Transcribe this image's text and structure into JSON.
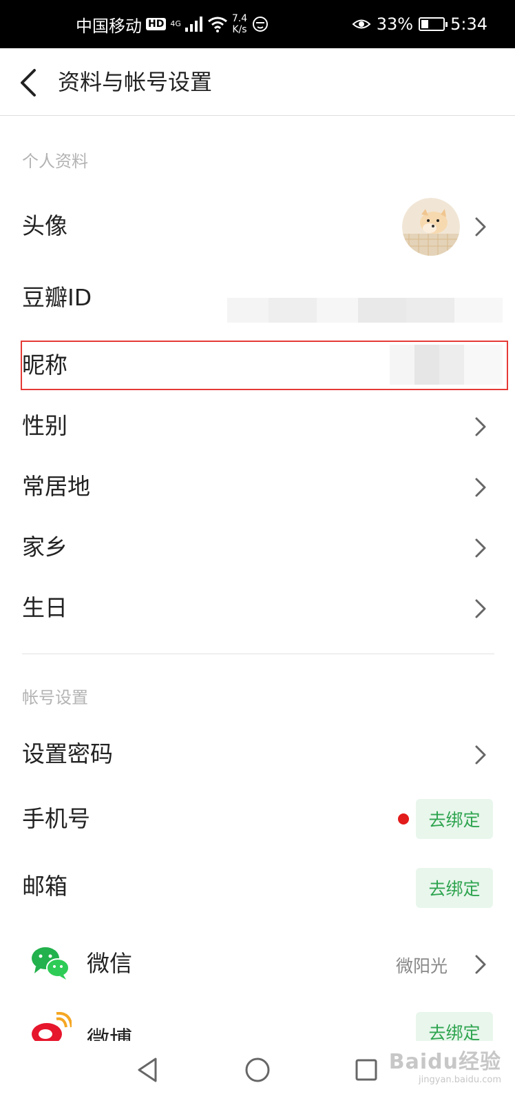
{
  "status_bar": {
    "carrier": "中国移动",
    "hd": "HD",
    "network": "4G",
    "speed_value": "7.4",
    "speed_unit": "K/s",
    "battery": "33%",
    "time": "5:34"
  },
  "header": {
    "title": "资料与帐号设置"
  },
  "profile_section": {
    "title": "个人资料",
    "rows": [
      {
        "label": "头像"
      },
      {
        "label": "豆瓣ID"
      },
      {
        "label": "昵称"
      },
      {
        "label": "性别"
      },
      {
        "label": "常居地"
      },
      {
        "label": "家乡"
      },
      {
        "label": "生日"
      }
    ]
  },
  "account_section": {
    "title": "帐号设置",
    "password_label": "设置密码",
    "phone_label": "手机号",
    "phone_button": "去绑定",
    "email_label": "邮箱",
    "email_button": "去绑定",
    "wechat_label": "微信",
    "wechat_value": "微阳光",
    "weibo_label": "微博",
    "weibo_button": "去绑定"
  },
  "colors": {
    "accent_green": "#2ea44f",
    "highlight_red": "#e53935",
    "notice_red": "#e21b1b"
  },
  "watermark": {
    "title": "Baidu经验",
    "subtitle": "jingyan.baidu.com"
  }
}
